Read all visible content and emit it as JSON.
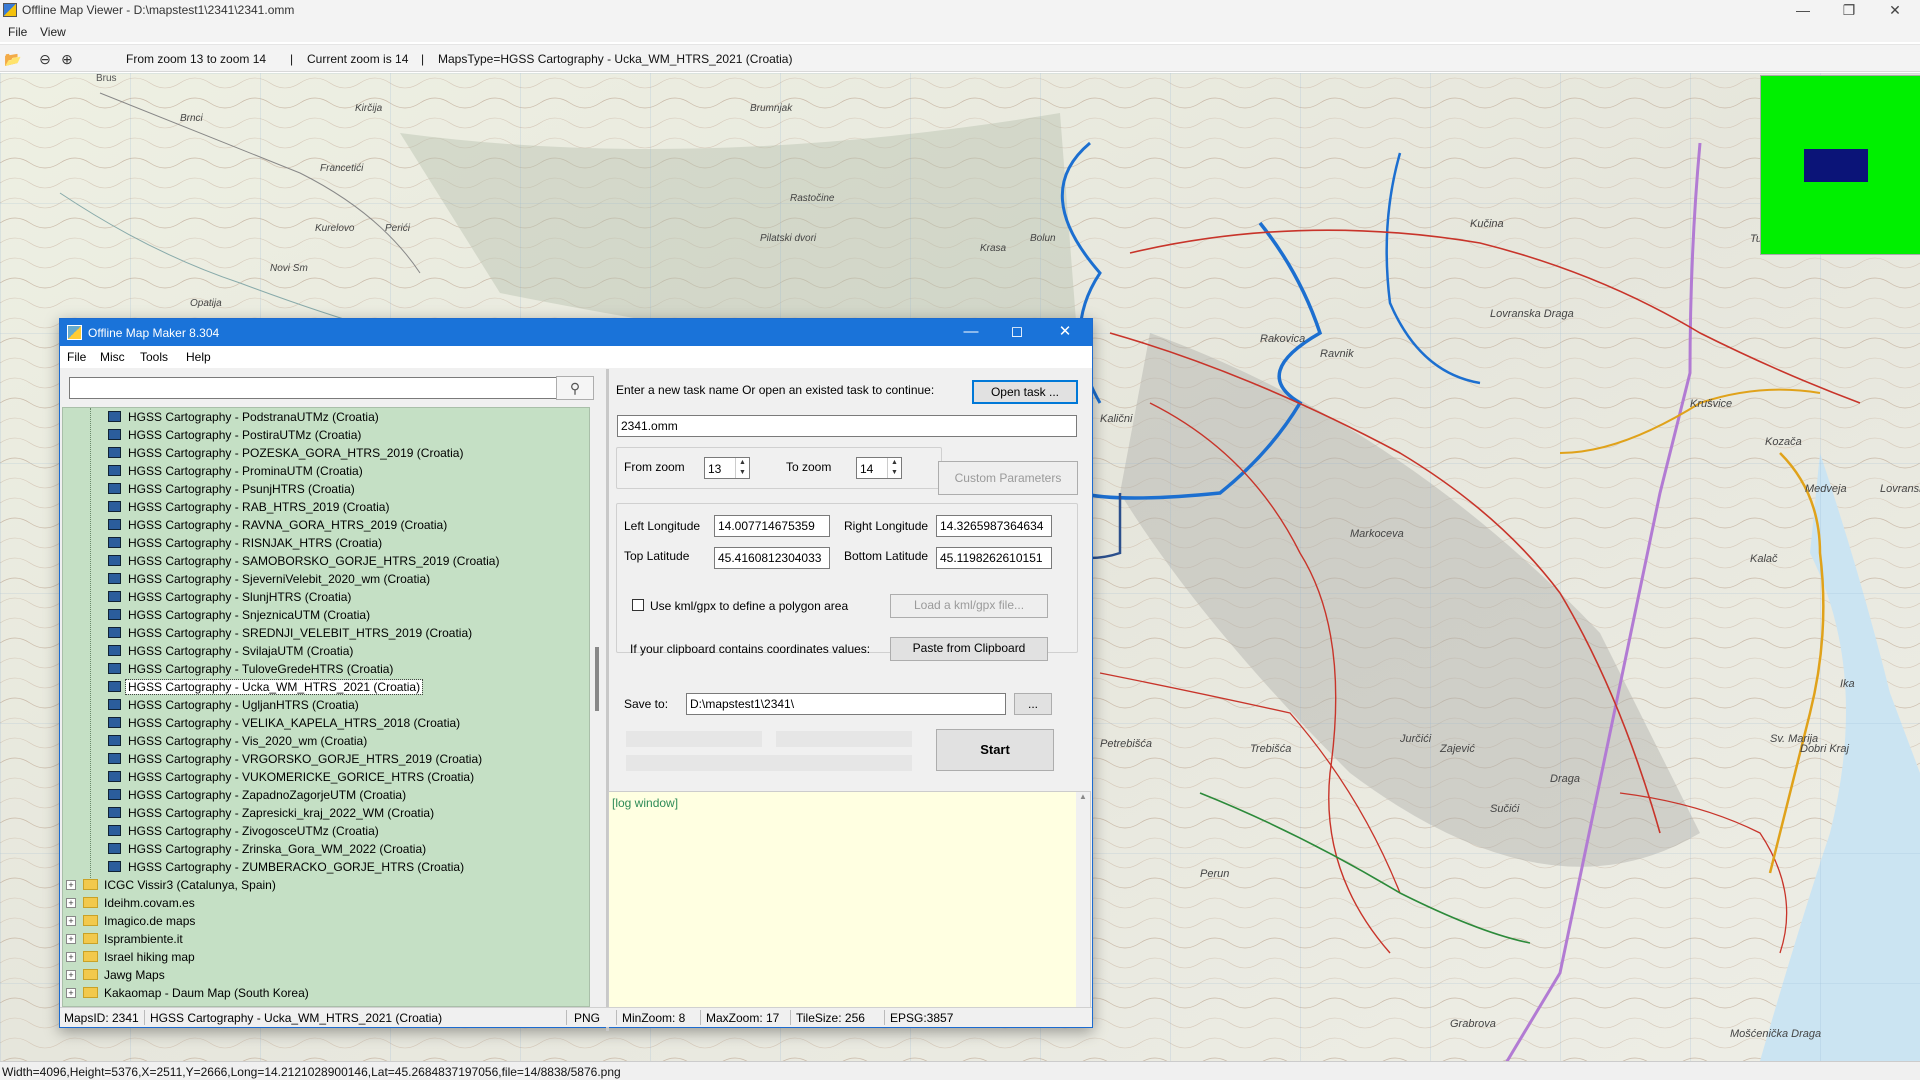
{
  "window": {
    "title": "Offline Map Viewer - D:\\mapstest1\\2341\\2341.omm",
    "menu": [
      "File",
      "View"
    ]
  },
  "toolbar": {
    "zoom_range": "From zoom 13 to zoom 14",
    "sep1": "|",
    "current_zoom": "Current zoom is 14",
    "sep2": "|",
    "maps_type": "MapsType=HGSS Cartography - Ucka_WM_HTRS_2021 (Croatia)"
  },
  "status": {
    "text": "Width=4096,Height=5376,X=2511,Y=2666,Long=14.2121028900146,Lat=45.2684837197056,file=14/8838/5876.png"
  },
  "map": {
    "labels": [
      "Brus",
      "Brnci",
      "Kirčija",
      "Francetići",
      "Kurelovo",
      "Perići",
      "Novi Sm",
      "Opatija",
      "Rastočine",
      "Pilatski dvori",
      "Brumnjak",
      "Krasa",
      "Bolun",
      "Lovranska Draga",
      "Kučina",
      "Tuliševica",
      "Ravnik",
      "Krušvice",
      "Markoceva",
      "Medveja",
      "Kozača",
      "Lovranski",
      "Trebišća",
      "Jurčići",
      "Zajević",
      "Sučići",
      "Dobri Kraj",
      "Mošćenička Draga",
      "Grabrova",
      "Petrebišća",
      "Perun",
      "Draga",
      "Kalač",
      "Ika",
      "Rakovica",
      "Kalični",
      "Sv. Marija"
    ],
    "overview_color": "#00f000",
    "viewport_color": "#0b1478"
  },
  "dialog": {
    "title": "Offline Map Maker 8.304",
    "menu": [
      "File",
      "Misc",
      "Tools",
      "Help"
    ],
    "search_placeholder": "",
    "tree_leaves": [
      "HGSS Cartography - PodstranaUTMz (Croatia)",
      "HGSS Cartography - PostiraUTMz (Croatia)",
      "HGSS Cartography - POZESKA_GORA_HTRS_2019 (Croatia)",
      "HGSS Cartography - ProminaUTM (Croatia)",
      "HGSS Cartography - PsunjHTRS (Croatia)",
      "HGSS Cartography - RAB_HTRS_2019 (Croatia)",
      "HGSS Cartography - RAVNA_GORA_HTRS_2019 (Croatia)",
      "HGSS Cartography - RISNJAK_HTRS (Croatia)",
      "HGSS Cartography - SAMOBORSKO_GORJE_HTRS_2019 (Croatia)",
      "HGSS Cartography - SjeverniVelebit_2020_wm (Croatia)",
      "HGSS Cartography - SlunjHTRS (Croatia)",
      "HGSS Cartography - SnjeznicaUTM (Croatia)",
      "HGSS Cartography - SREDNJI_VELEBIT_HTRS_2019 (Croatia)",
      "HGSS Cartography - SvilajaUTM (Croatia)",
      "HGSS Cartography - TuloveGredeHTRS (Croatia)",
      "HGSS Cartography - Ucka_WM_HTRS_2021 (Croatia)",
      "HGSS Cartography - UgljanHTRS (Croatia)",
      "HGSS Cartography - VELIKA_KAPELA_HTRS_2018 (Croatia)",
      "HGSS Cartography - Vis_2020_wm (Croatia)",
      "HGSS Cartography - VRGORSKO_GORJE_HTRS_2019 (Croatia)",
      "HGSS Cartography - VUKOMERICKE_GORICE_HTRS (Croatia)",
      "HGSS Cartography - ZapadnoZagorjeUTM (Croatia)",
      "HGSS Cartography - Zapresicki_kraj_2022_WM (Croatia)",
      "HGSS Cartography - ZivogosceUTMz (Croatia)",
      "HGSS Cartography - Zrinska_Gora_WM_2022 (Croatia)",
      "HGSS Cartography - ZUMBERACKO_GORJE_HTRS (Croatia)"
    ],
    "selected_leaf": "HGSS Cartography - Ucka_WM_HTRS_2021 (Croatia)",
    "tree_folders": [
      "ICGC Vissir3 (Catalunya, Spain)",
      "Ideihm.covam.es",
      "Imagico.de maps",
      "Isprambiente.it",
      "Israel hiking map",
      "Jawg Maps",
      "Kakaomap - Daum Map (South Korea)"
    ],
    "task_prompt": "Enter a new task name Or open an existed task to continue:",
    "open_task_btn": "Open task ...",
    "task_name": "2341.omm",
    "from_zoom_label": "From zoom",
    "from_zoom": "13",
    "to_zoom_label": "To zoom",
    "to_zoom": "14",
    "custom_params_btn": "Custom Parameters",
    "left_lon_label": "Left Longitude",
    "left_lon": "14.007714675359",
    "right_lon_label": "Right Longitude",
    "right_lon": "14.3265987364634",
    "top_lat_label": "Top Latitude",
    "top_lat": "45.4160812304033",
    "bottom_lat_label": "Bottom Latitude",
    "bottom_lat": "45.1198262610151",
    "kml_label": "Use kml/gpx to define a polygon area",
    "kml_btn": "Load a kml/gpx file...",
    "clipboard_label": "If your clipboard contains coordinates values:",
    "clipboard_btn": "Paste from Clipboard",
    "save_to_label": "Save to:",
    "save_to": "D:\\mapstest1\\2341\\",
    "browse_btn": "...",
    "start_btn": "Start",
    "log_text": "[log window]",
    "status": {
      "maps_id": "MapsID: 2341",
      "maps_name": "HGSS Cartography - Ucka_WM_HTRS_2021 (Croatia)",
      "format": "PNG",
      "min_zoom": "MinZoom: 8",
      "max_zoom": "MaxZoom: 17",
      "tile_size": "TileSize: 256",
      "epsg": "EPSG:3857"
    }
  }
}
